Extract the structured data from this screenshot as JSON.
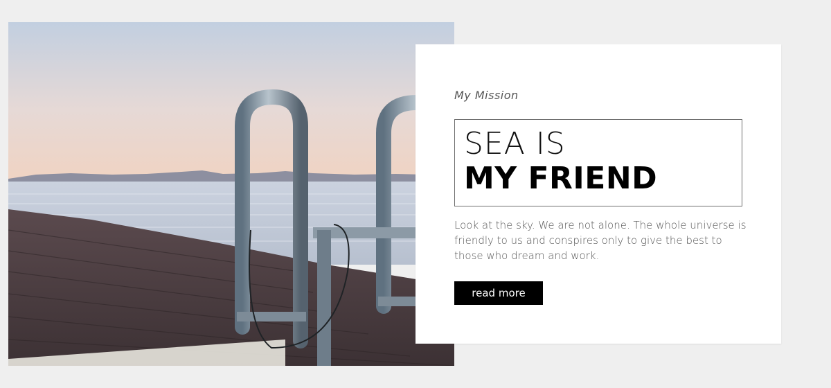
{
  "hero": {
    "eyebrow": "My Mission",
    "title_line1": "SEA IS",
    "title_line2": "MY FRIEND",
    "body": "Look at the sky. We are not alone. The whole universe is friendly to us and conspires only to give the best to those who dream and work.",
    "button_label": "read more"
  },
  "colors": {
    "page_background": "#efefef",
    "card_background": "#ffffff",
    "button_background": "#000000",
    "button_text": "#ffffff"
  }
}
